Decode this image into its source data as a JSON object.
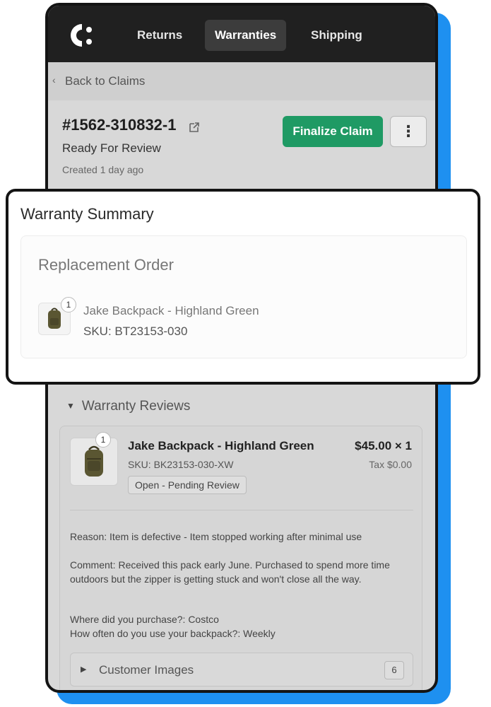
{
  "nav": {
    "tabs": [
      {
        "label": "Returns"
      },
      {
        "label": "Warranties"
      },
      {
        "label": "Shipping"
      }
    ]
  },
  "back": {
    "label": "Back to Claims"
  },
  "claim": {
    "id": "#1562-310832-1",
    "status": "Ready For Review",
    "created": "Created 1 day ago",
    "finalize_label": "Finalize Claim",
    "more_label": "⋮"
  },
  "summary": {
    "title": "Warranty Summary",
    "section_title": "Replacement Order",
    "item": {
      "name": "Jake Backpack - Highland Green",
      "sku": "SKU: BT23153-030",
      "qty": "1"
    }
  },
  "reviews": {
    "title": "Warranty Reviews",
    "item": {
      "name": "Jake Backpack - Highland Green",
      "sku": "SKU: BK23153-030-XW",
      "price": "$45.00 × 1",
      "tax": "Tax $0.00",
      "status": "Open - Pending Review",
      "qty": "1"
    },
    "reason": "Reason: Item is defective - Item stopped working after minimal use",
    "comment": "Comment: Received this pack early June. Purchased to spend more time outdoors but the zipper is getting stuck and won't close all the way.",
    "purchase": "Where did you purchase?: Costco",
    "usage": "How often do you use your backpack?: Weekly",
    "images": {
      "label": "Customer Images",
      "count": "6"
    }
  },
  "colors": {
    "accent_green": "#1f9a64",
    "shadow_blue": "#1e90f0",
    "nav_dark": "#202020"
  }
}
